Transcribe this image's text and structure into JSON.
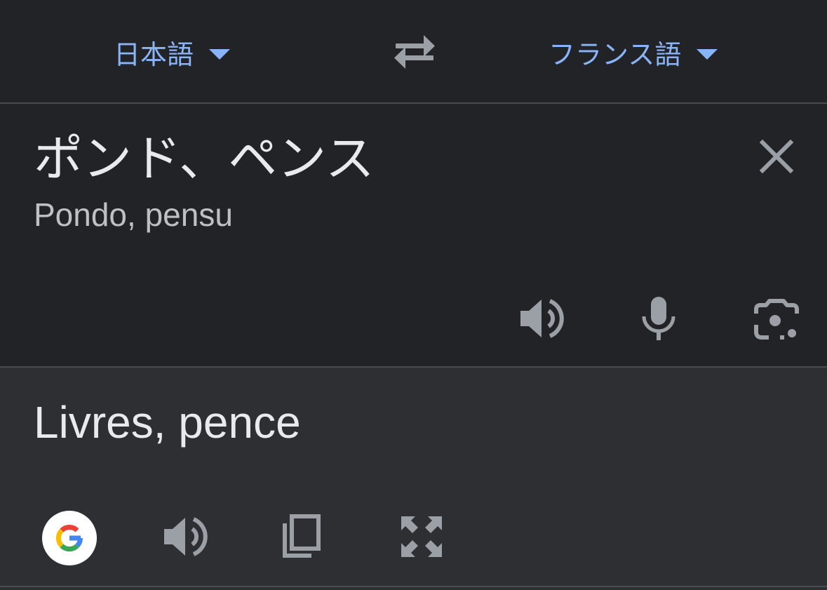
{
  "language_bar": {
    "source_language": "日本語",
    "target_language": "フランス語",
    "swap_icon": "swap-arrows-icon",
    "dropdown_icon": "caret-down-icon"
  },
  "source_panel": {
    "text": "ポンド、ペンス",
    "romanization": "Pondo, pensu",
    "icons": [
      "close-icon",
      "speaker-icon",
      "microphone-icon",
      "camera-lens-icon"
    ]
  },
  "result_panel": {
    "text": "Livres, pence",
    "icons": [
      "google-logo-icon",
      "speaker-icon",
      "copy-icon",
      "fullscreen-icon"
    ]
  },
  "colors": {
    "background": "#222327",
    "result_background": "#2e2f33",
    "accent": "#8ab4f8",
    "primary_text": "#e8eaed",
    "secondary_text": "#bdc1c6",
    "icon": "#9aa0a6",
    "divider": "#4a4b50"
  }
}
